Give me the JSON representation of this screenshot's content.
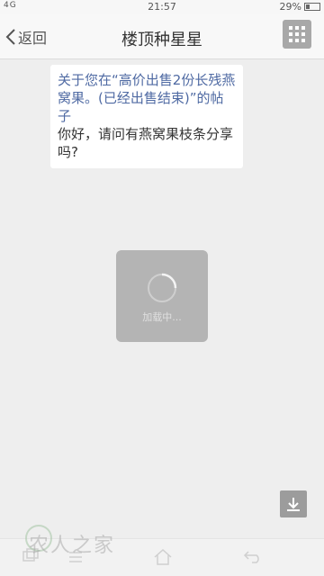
{
  "status_bar": {
    "signal": "4G",
    "time": "21:57",
    "battery": "29%"
  },
  "header": {
    "back_label": "返回",
    "title": "楼顶种星星",
    "menu_icon": "grid-icon"
  },
  "message": {
    "link_text": "关于您在“高价出售2份长残燕窝果。(已经出售结束)”的帖子",
    "body_text": "你好，请问有燕窝果枝条分享吗?"
  },
  "loading": {
    "label": "加载中..."
  },
  "download_icon": "download-icon",
  "watermark": "农人之家",
  "colors": {
    "link": "#4f6aa3",
    "background": "#eeeeee",
    "menu_button": "#a8a8a8"
  }
}
